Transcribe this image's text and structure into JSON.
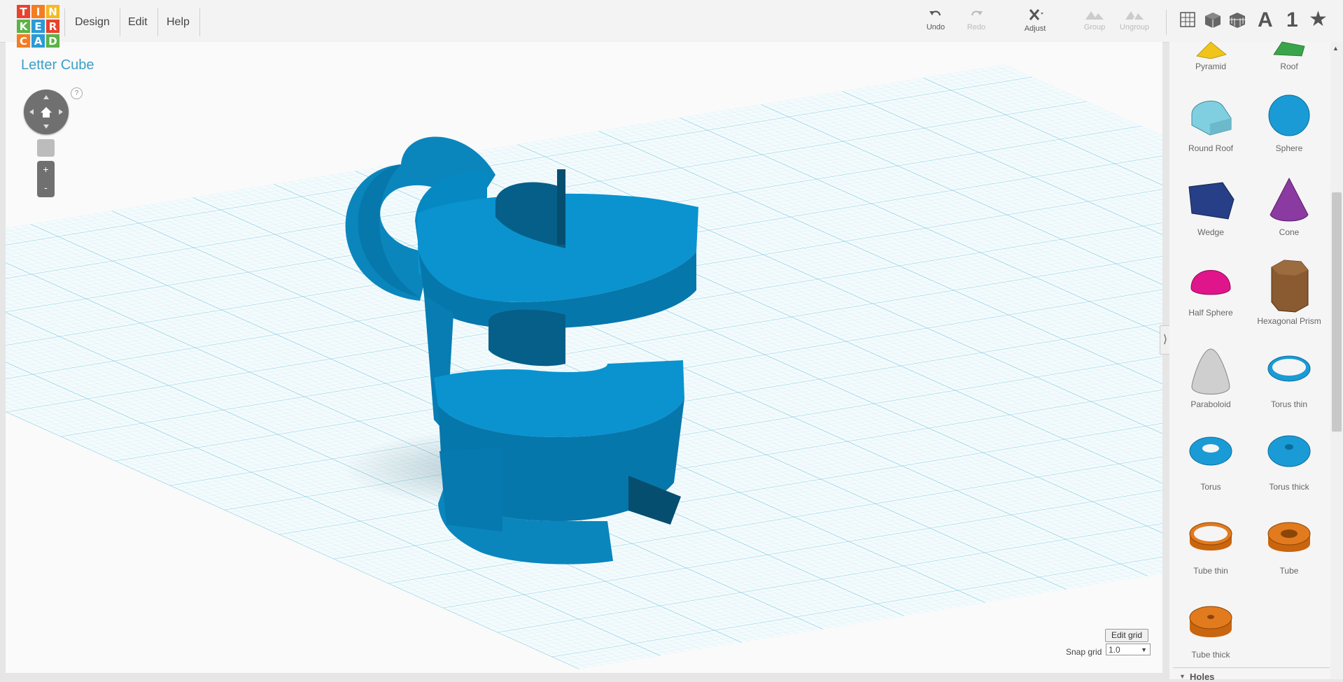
{
  "logo": {
    "letters": [
      "T",
      "I",
      "N",
      "K",
      "E",
      "R",
      "C",
      "A",
      "D"
    ],
    "colors": [
      "#e8432d",
      "#f57c22",
      "#f5b921",
      "#5bb346",
      "#2a9bd6",
      "#e8432d",
      "#f57c22",
      "#2a9bd6",
      "#5bb346"
    ]
  },
  "menu": {
    "design": "Design",
    "edit": "Edit",
    "help": "Help"
  },
  "toolbar": {
    "undo": "Undo",
    "redo": "Redo",
    "adjust": "Adjust",
    "group": "Group",
    "ungroup": "Ungroup"
  },
  "view_icons": [
    "grid-view-icon",
    "box-view-icon",
    "wireframe-box-icon",
    "letters-icon",
    "numbers-icon",
    "favorites-icon"
  ],
  "view_text": {
    "letters": "A",
    "numbers": "1",
    "star": "★"
  },
  "design_title": "Letter Cube",
  "nav": {
    "help": "?",
    "zoom_in": "+",
    "zoom_out": "-"
  },
  "grid": {
    "edit_grid": "Edit grid",
    "snap_label": "Snap grid",
    "snap_value": "1.0",
    "dropdown": "▼"
  },
  "collapse": "⟩",
  "shapes": [
    {
      "name": "Pyramid",
      "color": "#f0c419"
    },
    {
      "name": "Roof",
      "color": "#3aa44a"
    },
    {
      "name": "Round Roof",
      "color": "#7fcfe0"
    },
    {
      "name": "Sphere",
      "color": "#1a9bd6"
    },
    {
      "name": "Wedge",
      "color": "#263f86"
    },
    {
      "name": "Cone",
      "color": "#8a3aa0"
    },
    {
      "name": "Half Sphere",
      "color": "#e0158c"
    },
    {
      "name": "Hexagonal Prism",
      "color": "#8a5a30"
    },
    {
      "name": "Paraboloid",
      "color": "#cfcfcf"
    },
    {
      "name": "Torus thin",
      "color": "#1a9bd6"
    },
    {
      "name": "Torus",
      "color": "#1a9bd6"
    },
    {
      "name": "Torus thick",
      "color": "#1a9bd6"
    },
    {
      "name": "Tube thin",
      "color": "#e27a1e"
    },
    {
      "name": "Tube",
      "color": "#e27a1e"
    },
    {
      "name": "Tube thick",
      "color": "#e27a1e"
    }
  ],
  "holes_section": "Holes",
  "colors": {
    "accent": "#3aa0c8",
    "model": "#0a8fc7",
    "grid_line": "#a9dbea"
  }
}
